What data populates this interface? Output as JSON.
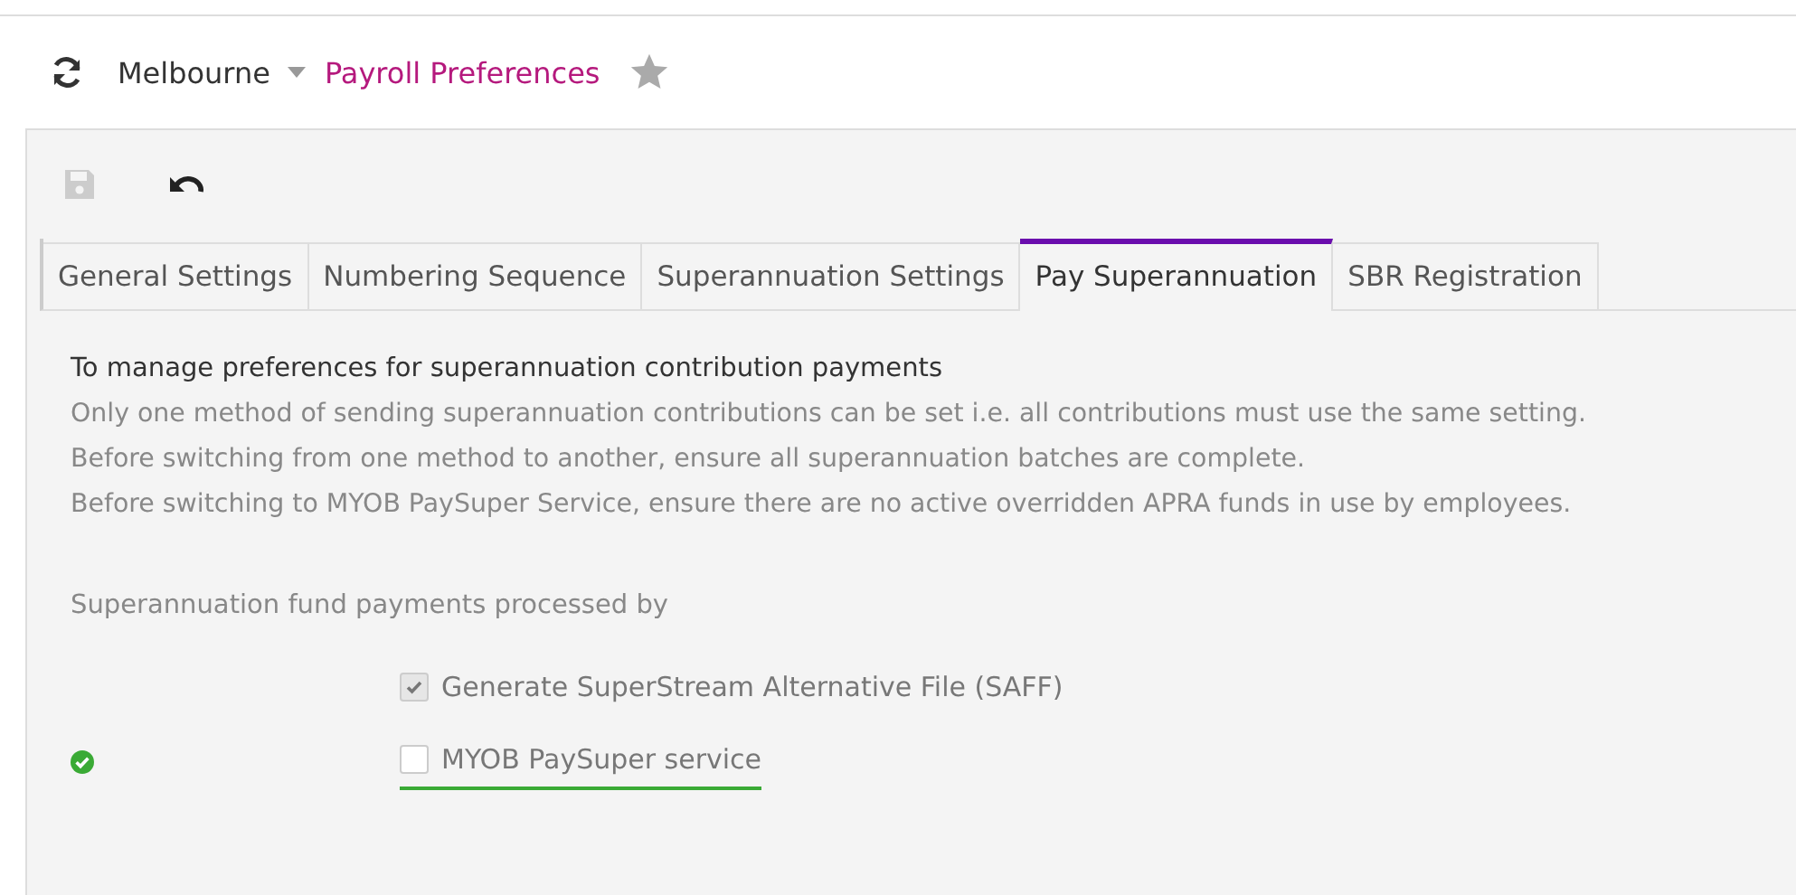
{
  "breadcrumb": {
    "company": "Melbourne",
    "page": "Payroll Preferences"
  },
  "toolbar": {
    "save_disabled": true
  },
  "tabs": [
    {
      "label": "General Settings",
      "selected": false
    },
    {
      "label": "Numbering Sequence",
      "selected": false
    },
    {
      "label": "Superannuation Settings",
      "selected": false
    },
    {
      "label": "Pay Superannuation",
      "selected": true
    },
    {
      "label": "SBR Registration",
      "selected": false
    }
  ],
  "heading": "To manage preferences for superannuation contribution payments",
  "notes": [
    "Only one method of sending superannuation contributions can be set i.e. all contributions must use the same setting.",
    "Before switching from one method to another, ensure all superannuation batches are complete.",
    "Before switching to MYOB PaySuper Service, ensure there are no active overridden APRA funds in use by employees."
  ],
  "field_label": "Superannuation fund payments processed by",
  "options": [
    {
      "label": "Generate SuperStream Alternative File (SAFF)",
      "checked": true,
      "disabled": true,
      "validated": false,
      "focused": false
    },
    {
      "label": "MYOB PaySuper service",
      "checked": false,
      "disabled": false,
      "validated": true,
      "focused": true
    }
  ]
}
